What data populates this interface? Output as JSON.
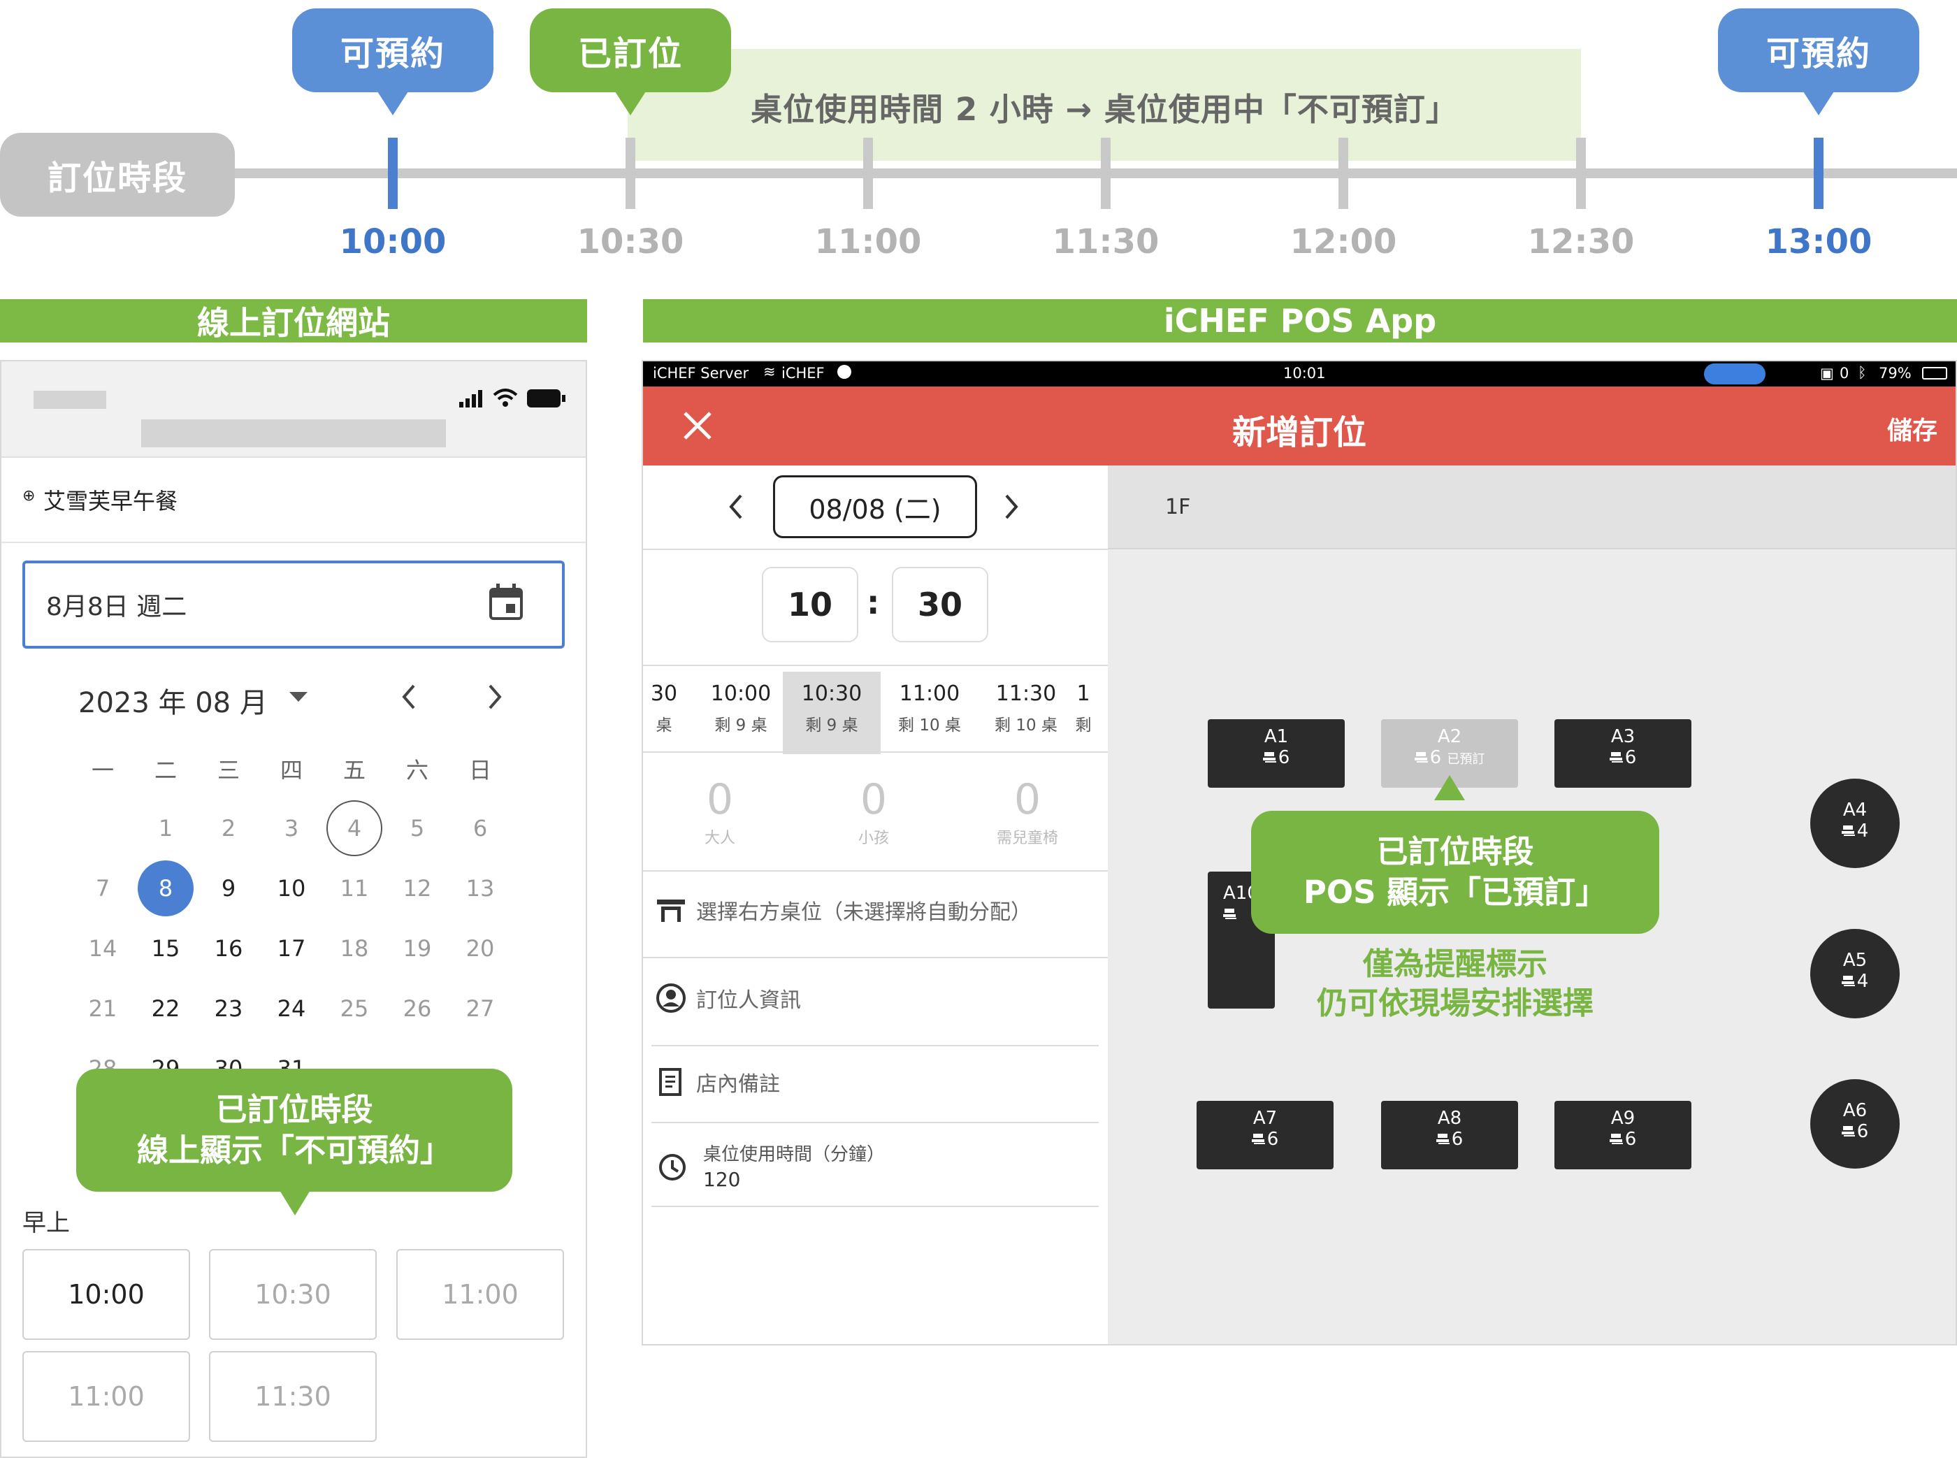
{
  "timeline": {
    "label": "訂位時段",
    "band_text": "桌位使用時間 2 小時 → 桌位使用中「不可預訂」",
    "times": [
      "10:00",
      "10:30",
      "11:00",
      "11:30",
      "12:00",
      "12:30",
      "13:00"
    ],
    "flags": {
      "available_1": "可預約",
      "booked": "已訂位",
      "available_2": "可預約"
    },
    "colors": {
      "blue": "#4a7fd1",
      "green": "#78b542",
      "grey": "#c9c9c9"
    }
  },
  "left_section": {
    "header": "線上訂位網站",
    "store_name": "艾雪芙早午餐",
    "date_input_value": "8月8日 週二",
    "month_title": "2023 年 08 月",
    "weekdays": [
      "一",
      "二",
      "三",
      "四",
      "五",
      "六",
      "日"
    ],
    "days": [
      "1",
      "2",
      "3",
      "4",
      "5",
      "6",
      "7",
      "8",
      "9",
      "10",
      "11",
      "12",
      "13",
      "14",
      "15",
      "16",
      "17",
      "18",
      "19",
      "20",
      "21",
      "22",
      "23",
      "24",
      "25",
      "26",
      "27",
      "28",
      "29",
      "30",
      "31"
    ],
    "callout_line1": "已訂位時段",
    "callout_line2": "線上顯示「不可預約」",
    "period_label": "早上",
    "slots": [
      "10:00",
      "10:30",
      "11:00",
      "11:00",
      "11:30"
    ]
  },
  "right_section": {
    "header": "iCHEF POS App",
    "status": {
      "left": "iCHEF Server",
      "wifi": "iCHEF",
      "time": "10:01",
      "battery": "79%",
      "count": "0"
    },
    "title": "新增訂位",
    "save_label": "儲存",
    "date_value": "08/08 (二)",
    "floor": "1F",
    "hour": "10",
    "minute": "30",
    "time_slots": [
      {
        "time": "30",
        "remain": "桌"
      },
      {
        "time": "10:00",
        "remain": "剩 9 桌"
      },
      {
        "time": "10:30",
        "remain": "剩 9 桌"
      },
      {
        "time": "11:00",
        "remain": "剩 10 桌"
      },
      {
        "time": "11:30",
        "remain": "剩 10 桌"
      },
      {
        "time": "1",
        "remain": "剩"
      }
    ],
    "counts": [
      {
        "n": "0",
        "label": "大人"
      },
      {
        "n": "0",
        "label": "小孩"
      },
      {
        "n": "0",
        "label": "需兒童椅"
      }
    ],
    "table_select": "選擇右方桌位（未選擇將自動分配）",
    "guest_info": "訂位人資訊",
    "store_note": "店內備註",
    "duration_label": "桌位使用時間（分鐘）",
    "duration_value": "120",
    "tables": [
      {
        "name": "A1",
        "seats": "6"
      },
      {
        "name": "A2",
        "seats": "6",
        "status": "已預訂"
      },
      {
        "name": "A3",
        "seats": "6"
      },
      {
        "name": "A4",
        "seats": "4"
      },
      {
        "name": "A5",
        "seats": "4"
      },
      {
        "name": "A6",
        "seats": "6"
      },
      {
        "name": "A7",
        "seats": "6"
      },
      {
        "name": "A8",
        "seats": "6"
      },
      {
        "name": "A9",
        "seats": "6"
      },
      {
        "name": "A10",
        "seats": ""
      }
    ],
    "callout_line1": "已訂位時段",
    "callout_line2": "POS 顯示「已預訂」",
    "note_line1": "僅為提醒標示",
    "note_line2": "仍可依現場安排選擇"
  }
}
